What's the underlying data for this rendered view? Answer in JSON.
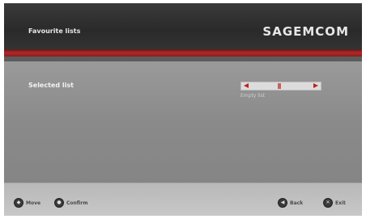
{
  "header": {
    "title": "Favourite lists",
    "brand": "SAGEMCOM"
  },
  "content": {
    "row_label": "Selected list",
    "selector_subtext": "Empty list"
  },
  "footer": {
    "move_label": "Move",
    "confirm_label": "Confirm",
    "back_label": "Back",
    "exit_label": "Exit",
    "back_icon_glyph": "◀",
    "exit_icon_glyph": "✕"
  },
  "colors": {
    "accent_red": "#c02020",
    "header_bg": "#2e2e2e",
    "content_bg": "#8e8e8e"
  }
}
